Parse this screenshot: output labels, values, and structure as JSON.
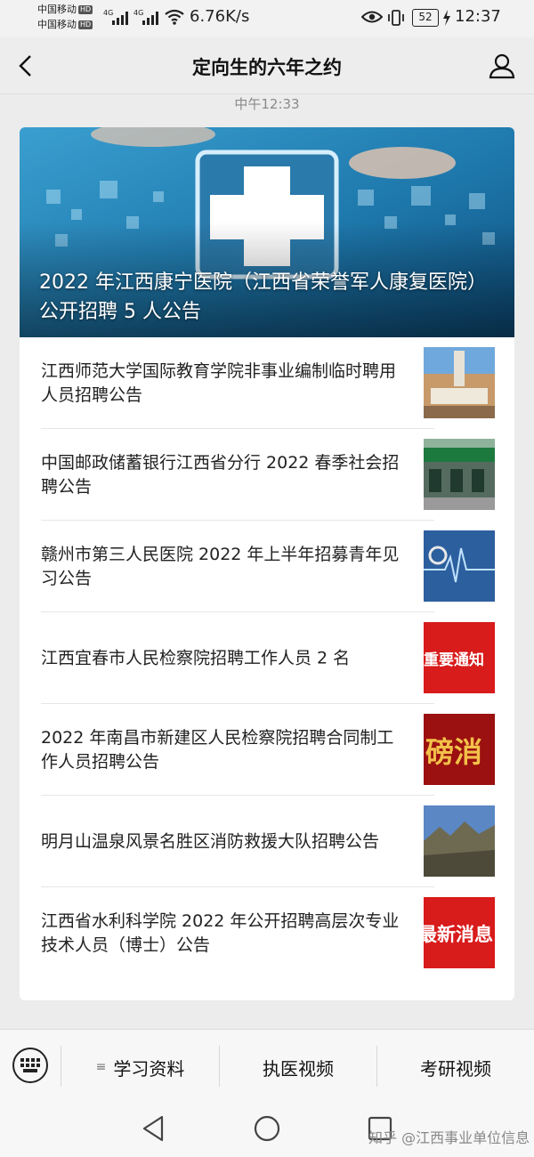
{
  "status_bar": {
    "carrier_1": "中国移动",
    "carrier_2": "中国移动",
    "hd_badge": "HD",
    "network_type": "4G",
    "network_speed": "6.76K/s",
    "battery_level": "52",
    "time": "12:37"
  },
  "header": {
    "title": "定向生的六年之约"
  },
  "timestamp": "中午12:33",
  "hero": {
    "title": "2022 年江西康宁医院（江西省荣誉军人康复医院）公开招聘 5 人公告"
  },
  "articles": [
    {
      "title": "江西师范大学国际教育学院非事业编制临时聘用人员招聘公告",
      "thumb_text": ""
    },
    {
      "title": "中国邮政储蓄银行江西省分行 2022 春季社会招聘公告",
      "thumb_text": ""
    },
    {
      "title": "赣州市第三人民医院 2022 年上半年招募青年见习公告",
      "thumb_text": ""
    },
    {
      "title": "江西宜春市人民检察院招聘工作人员 2 名",
      "thumb_text": "重要通知"
    },
    {
      "title": "2022 年南昌市新建区人民检察院招聘合同制工作人员招聘公告",
      "thumb_text": "磅消"
    },
    {
      "title": "明月山温泉风景名胜区消防救援大队招聘公告",
      "thumb_text": ""
    },
    {
      "title": "江西省水利科学院 2022 年公开招聘高层次专业技术人员（博士）公告",
      "thumb_text": "最新消息"
    }
  ],
  "menu": {
    "items": [
      {
        "label": "学习资料",
        "lines_icon": "≡"
      },
      {
        "label": "执医视频"
      },
      {
        "label": "考研视频"
      }
    ]
  },
  "watermark": "知乎 @江西事业单位信息",
  "colors": {
    "page_bg": "#ececec",
    "card_bg": "#ffffff",
    "hero_blue": "#2e8fc4",
    "notice_red": "#d81b1b"
  }
}
